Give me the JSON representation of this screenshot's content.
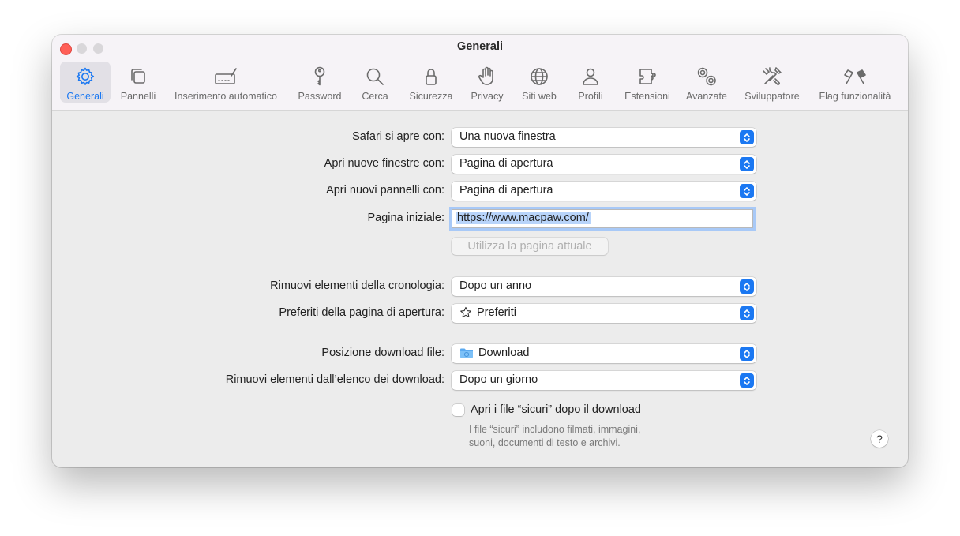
{
  "window": {
    "title": "Generali"
  },
  "toolbar": {
    "tabs": [
      {
        "label": "Generali",
        "icon": "gear-icon",
        "active": true
      },
      {
        "label": "Pannelli",
        "icon": "tabs-icon"
      },
      {
        "label": "Inserimento automatico",
        "icon": "autofill-icon"
      },
      {
        "label": "Password",
        "icon": "key-icon"
      },
      {
        "label": "Cerca",
        "icon": "magnifier-icon"
      },
      {
        "label": "Sicurezza",
        "icon": "lock-icon"
      },
      {
        "label": "Privacy",
        "icon": "hand-icon"
      },
      {
        "label": "Siti web",
        "icon": "globe-icon"
      },
      {
        "label": "Profili",
        "icon": "person-icon"
      },
      {
        "label": "Estensioni",
        "icon": "puzzle-icon"
      },
      {
        "label": "Avanzate",
        "icon": "gears-icon"
      },
      {
        "label": "Sviluppatore",
        "icon": "tools-icon"
      },
      {
        "label": "Flag funzionalità",
        "icon": "flags-icon"
      }
    ],
    "accent_color": "#1b78f2"
  },
  "settings": {
    "safari_opens_with": {
      "label": "Safari si apre con:",
      "value": "Una nuova finestra"
    },
    "new_windows": {
      "label": "Apri nuove finestre con:",
      "value": "Pagina di apertura"
    },
    "new_tabs": {
      "label": "Apri nuovi pannelli con:",
      "value": "Pagina di apertura"
    },
    "homepage": {
      "label": "Pagina iniziale:",
      "value": "https://www.macpaw.com/"
    },
    "use_current_page": "Utilizza la pagina attuale",
    "history": {
      "label": "Rimuovi elementi della cronologia:",
      "value": "Dopo un anno"
    },
    "favorites": {
      "label": "Preferiti della pagina di apertura:",
      "value": "Preferiti"
    },
    "download_location": {
      "label": "Posizione download file:",
      "value": "Download"
    },
    "download_list": {
      "label": "Rimuovi elementi dall’elenco dei download:",
      "value": "Dopo un giorno"
    },
    "safe_files": {
      "label": "Apri i file “sicuri” dopo il download",
      "checked": false,
      "hint_line1": "I file “sicuri” includono filmati, immagini,",
      "hint_line2": "suoni, documenti di testo e archivi."
    },
    "help": "?"
  }
}
